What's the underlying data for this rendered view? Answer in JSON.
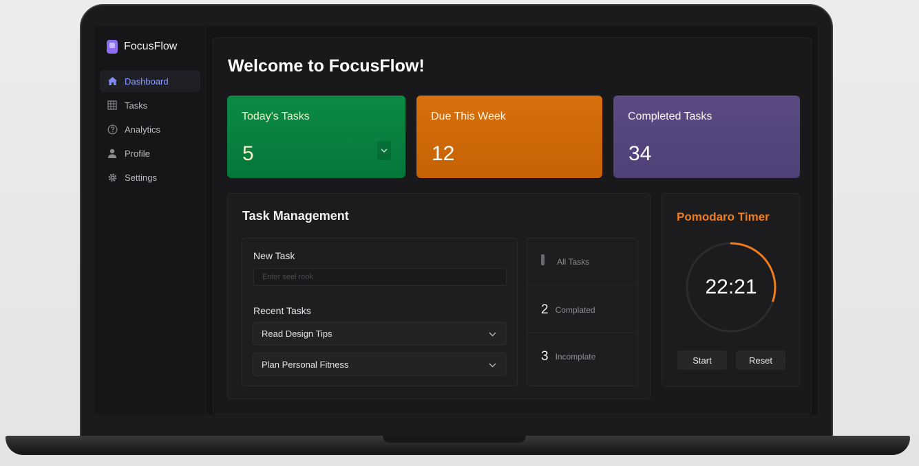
{
  "brand": {
    "name": "FocusFlow"
  },
  "sidebar": {
    "items": [
      {
        "label": "Dashboard",
        "icon": "home-icon",
        "active": true
      },
      {
        "label": "Tasks",
        "icon": "grid-icon",
        "active": false
      },
      {
        "label": "Analytics",
        "icon": "help-circle-icon",
        "active": false
      },
      {
        "label": "Profile",
        "icon": "user-icon",
        "active": false
      },
      {
        "label": "Settings",
        "icon": "gear-icon",
        "active": false
      }
    ]
  },
  "header": {
    "title": "Welcome to FocusFlow!"
  },
  "stats": [
    {
      "label": "Today's Tasks",
      "value": "5",
      "color": "#0a8541"
    },
    {
      "label": "Due This Week",
      "value": "12",
      "color": "#d06a0a"
    },
    {
      "label": "Completed Tasks",
      "value": "34",
      "color": "#564680"
    }
  ],
  "task_management": {
    "title": "Task Management",
    "new_task_label": "New Task",
    "new_task_placeholder": "Enter seel rook",
    "recent_label": "Recent Tasks",
    "recent_tasks": [
      "Read Design Tips",
      "Plan Personal Fitness"
    ],
    "filters": [
      {
        "count": "",
        "label": "All Tasks"
      },
      {
        "count": "2",
        "label": "Complated"
      },
      {
        "count": "3",
        "label": "Incomplate"
      }
    ]
  },
  "timer": {
    "title": "Pomodaro Timer",
    "time": "22:21",
    "progress": 0.3,
    "start_label": "Start",
    "reset_label": "Reset",
    "accent": "#ef7d1f"
  }
}
